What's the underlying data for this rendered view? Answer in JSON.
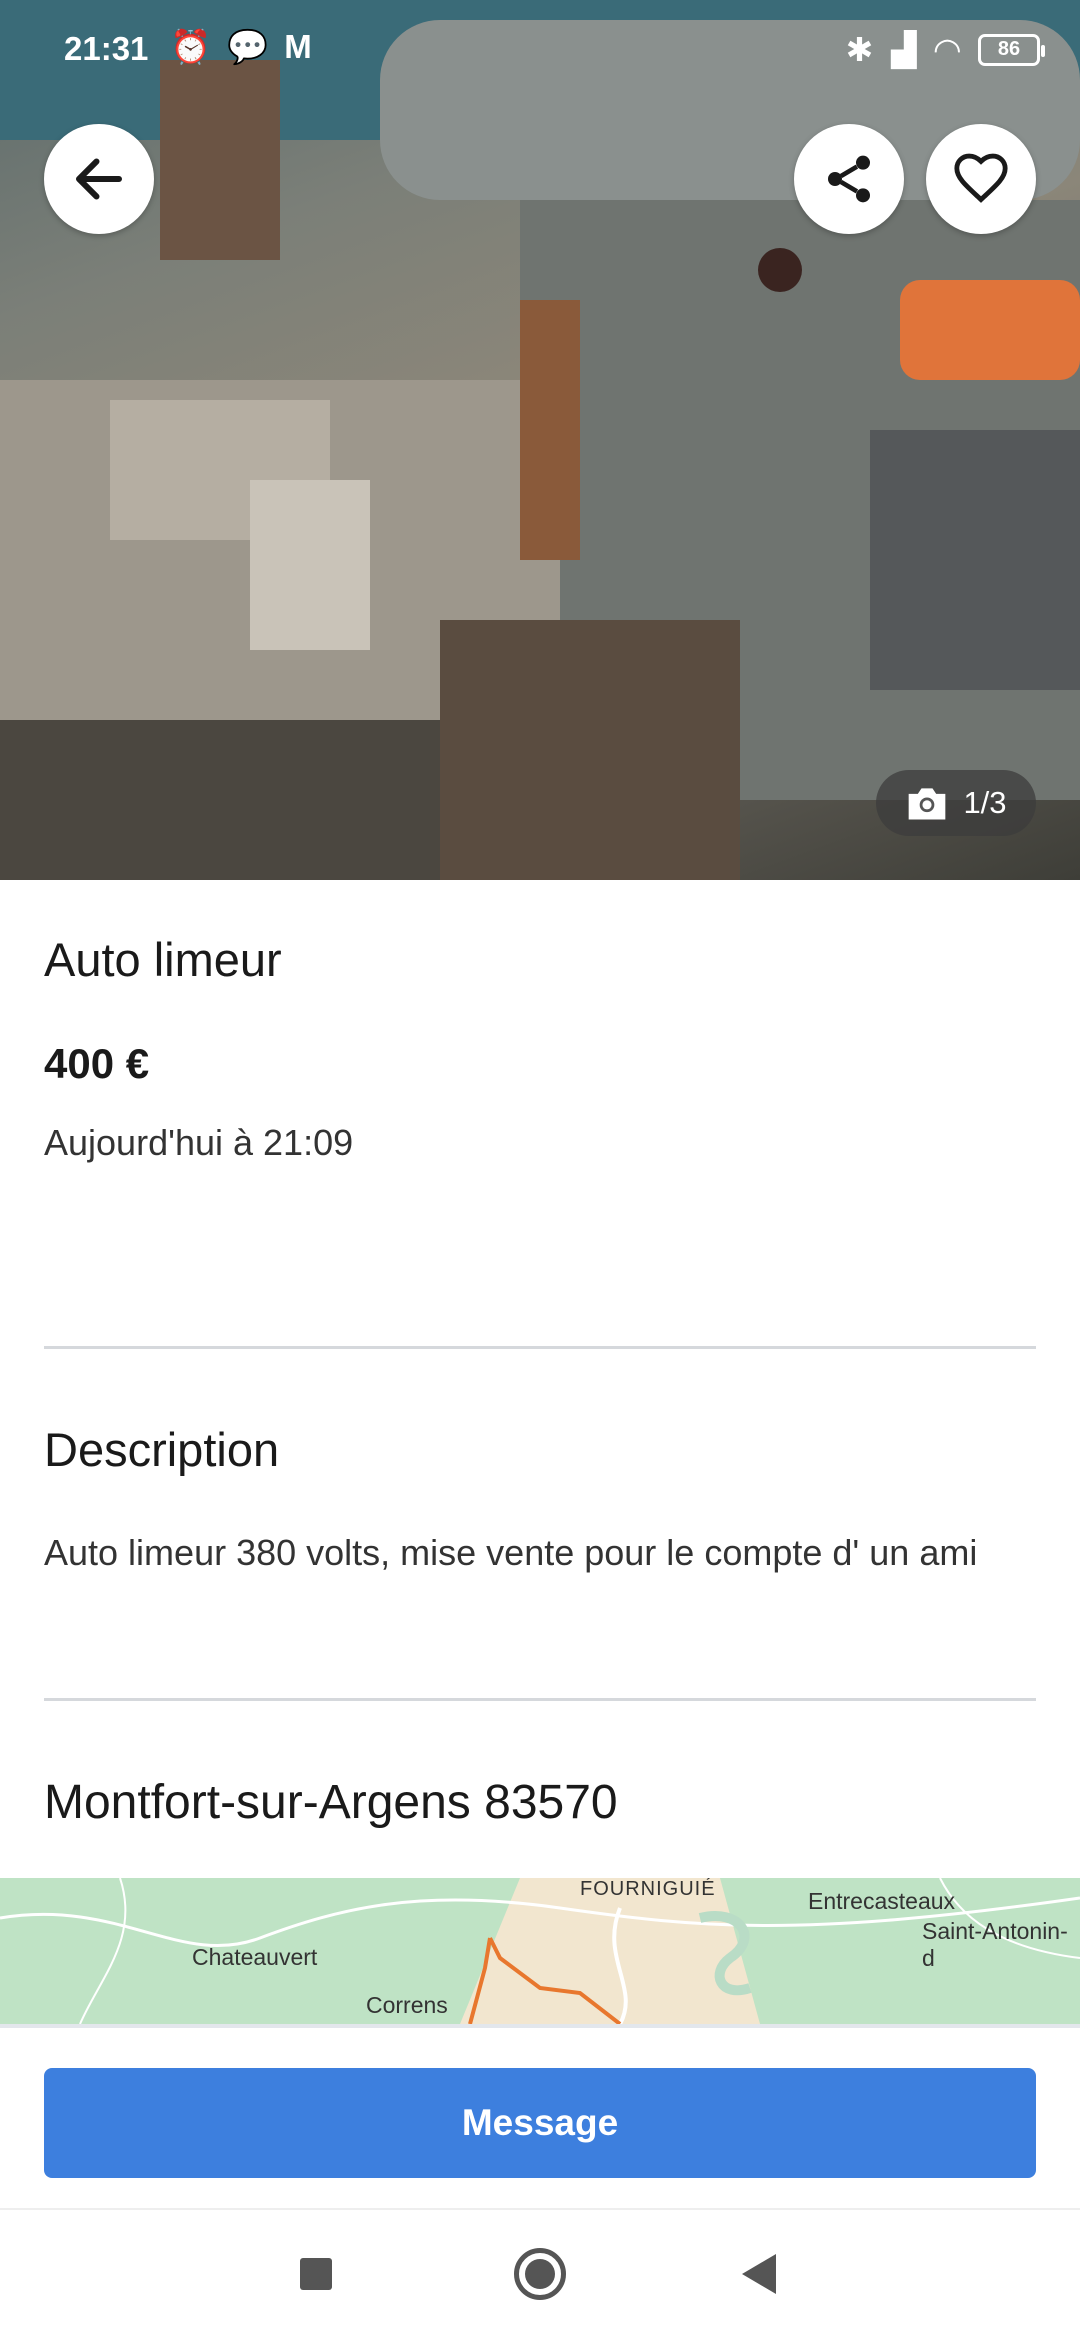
{
  "status_bar": {
    "time": "21:31",
    "left_icons": [
      "alarm-icon",
      "chat-icon",
      "gmail-icon"
    ],
    "right_icons": [
      "bluetooth-icon",
      "signal-icon",
      "wifi-icon"
    ],
    "battery": "86"
  },
  "photo": {
    "counter": "1/3",
    "camera_icon": "camera-icon"
  },
  "listing": {
    "title": "Auto limeur",
    "price": "400 €",
    "date": "Aujourd'hui à 21:09"
  },
  "description": {
    "heading": "Description",
    "text": "Auto limeur 380 volts, mise vente pour le compte d' un ami"
  },
  "location": {
    "heading": "Montfort-sur-Argens 83570"
  },
  "map": {
    "labels": [
      "FOURNIGUIÉ",
      "Entrecasteaux",
      "Saint-Antonin-d",
      "Chateauvert",
      "Correns"
    ]
  },
  "actions": {
    "message_label": "Message"
  },
  "colors": {
    "accent": "#3d7fde",
    "map_green": "#bfe3c5",
    "route": "#e8772e"
  }
}
